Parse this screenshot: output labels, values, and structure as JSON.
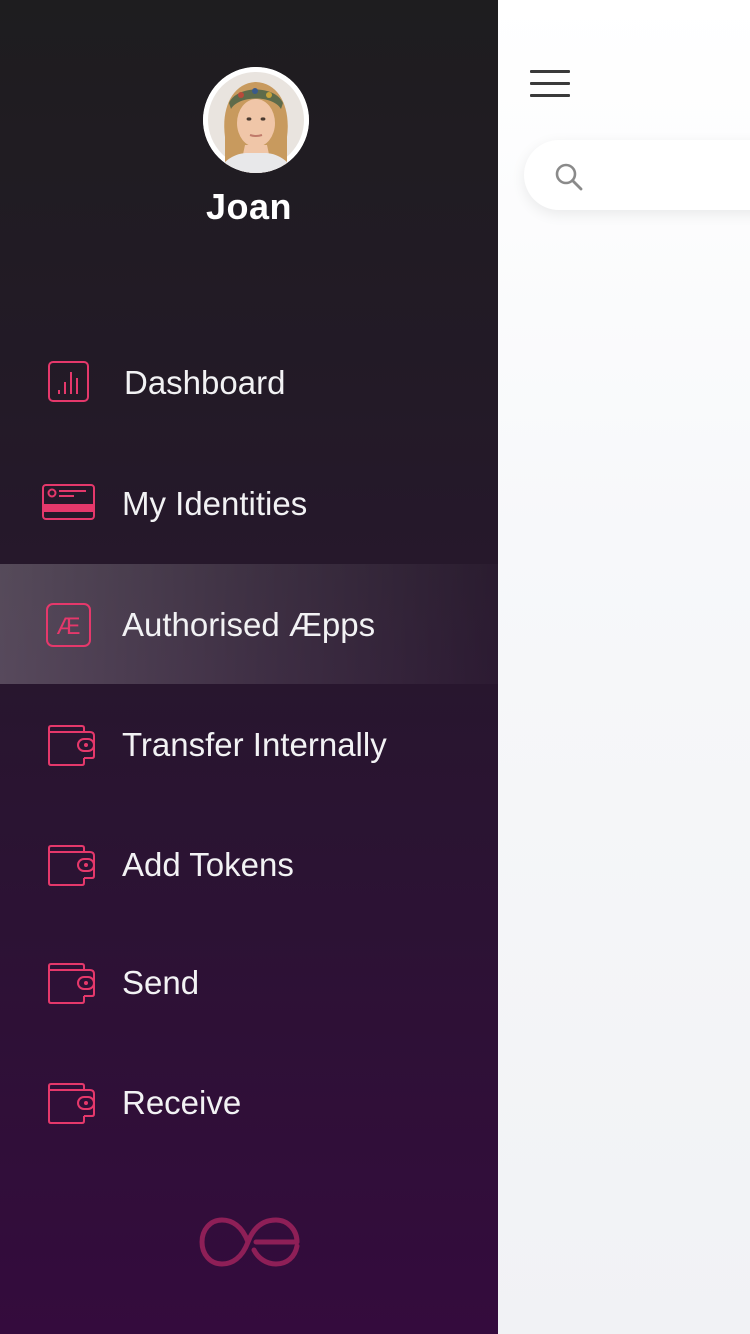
{
  "drawer": {
    "user": {
      "name": "Joan"
    },
    "items": [
      {
        "label": "Dashboard",
        "icon": "bar-chart-icon"
      },
      {
        "label": "My Identities",
        "icon": "id-card-icon"
      },
      {
        "label": "Authorised Æpps",
        "icon": "ae-icon",
        "active": true
      },
      {
        "label": "Transfer Internally",
        "icon": "wallet-icon"
      },
      {
        "label": "Add Tokens",
        "icon": "wallet-icon"
      },
      {
        "label": "Send",
        "icon": "wallet-icon"
      },
      {
        "label": "Receive",
        "icon": "wallet-icon"
      }
    ],
    "logo": "aeternity-logo"
  },
  "main": {
    "menu_icon": "hamburger-menu-icon",
    "search": {
      "value": "",
      "placeholder": "",
      "icon": "search-icon"
    }
  },
  "colors": {
    "accent": "#e5386b",
    "drawer_top": "#1e1d1f",
    "drawer_bottom": "#340b3d",
    "text": "#f2f2f4",
    "logo": "#8e1f57"
  }
}
